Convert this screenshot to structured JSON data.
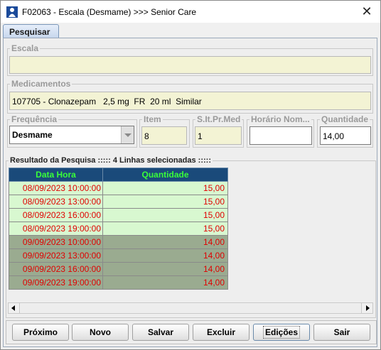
{
  "window": {
    "title": "F02063 - Escala (Desmame) >>> Senior Care",
    "close_glyph": "✕"
  },
  "tabs": [
    {
      "label": "Pesquisar",
      "active": true
    }
  ],
  "escala": {
    "label": "Escala",
    "value": ""
  },
  "medicamentos": {
    "label": "Medicamentos",
    "value": "107705 - Clonazepam   2,5 mg  FR  20 ml  Similar"
  },
  "frequencia": {
    "label": "Frequência",
    "value": "Desmame"
  },
  "item": {
    "label": "Item",
    "value": "8"
  },
  "slt_pr_med": {
    "label": "S.It.Pr.Med",
    "value": "1"
  },
  "horario": {
    "label": "Horário Nom...",
    "value": ""
  },
  "quantidade": {
    "label": "Quantidade",
    "value": "14,00"
  },
  "results": {
    "legend": "Resultado da Pesquisa ::::: 4 Linhas selecionadas :::::",
    "columns": [
      "Data Hora",
      "Quantidade"
    ],
    "rows": [
      {
        "data_hora": "08/09/2023 10:00:00",
        "quantidade": "15,00",
        "selected": true
      },
      {
        "data_hora": "08/09/2023 13:00:00",
        "quantidade": "15,00",
        "selected": true
      },
      {
        "data_hora": "08/09/2023 16:00:00",
        "quantidade": "15,00",
        "selected": true
      },
      {
        "data_hora": "08/09/2023 19:00:00",
        "quantidade": "15,00",
        "selected": true
      },
      {
        "data_hora": "09/09/2023 10:00:00",
        "quantidade": "14,00",
        "selected": false
      },
      {
        "data_hora": "09/09/2023 13:00:00",
        "quantidade": "14,00",
        "selected": false
      },
      {
        "data_hora": "09/09/2023 16:00:00",
        "quantidade": "14,00",
        "selected": false
      },
      {
        "data_hora": "09/09/2023 19:00:00",
        "quantidade": "14,00",
        "selected": false
      }
    ]
  },
  "buttons": {
    "proximo": "Próximo",
    "novo": "Novo",
    "salvar": "Salvar",
    "excluir": "Excluir",
    "edicoes": "Edições",
    "sair": "Sair"
  },
  "colors": {
    "header_bg": "#1a4a7a",
    "header_text": "#39ff39",
    "cell_text": "#e00000",
    "row_selected_bg": "#d8f8d0",
    "row_bg": "#9aab90",
    "field_bg": "#f3f3d4"
  },
  "icons": {
    "app": "user-icon",
    "close": "close-icon",
    "combo": "chevron-down-icon",
    "scroll_left": "arrow-left-icon",
    "scroll_right": "arrow-right-icon"
  }
}
